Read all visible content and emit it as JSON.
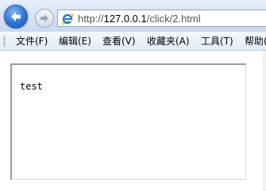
{
  "navigation": {
    "back_icon": "back-arrow-icon",
    "forward_icon": "forward-arrow-icon",
    "address": {
      "browser_icon": "ie-logo-icon",
      "url_scheme": "http://",
      "url_host": "127.0.0.1",
      "url_path": "/click/2.html"
    }
  },
  "menu": {
    "items": [
      {
        "label": "文件(F)"
      },
      {
        "label": "编辑(E)"
      },
      {
        "label": "查看(V)"
      },
      {
        "label": "收藏夹(A)"
      },
      {
        "label": "工具(T)"
      },
      {
        "label": "帮助(H)"
      }
    ]
  },
  "page": {
    "frame_text": "test"
  },
  "colors": {
    "nav_gradient_top": "#e6eefa",
    "nav_gradient_bottom": "#c9d9ee",
    "back_button": "#2f73d6",
    "ie_logo": "#1e7fd8"
  }
}
